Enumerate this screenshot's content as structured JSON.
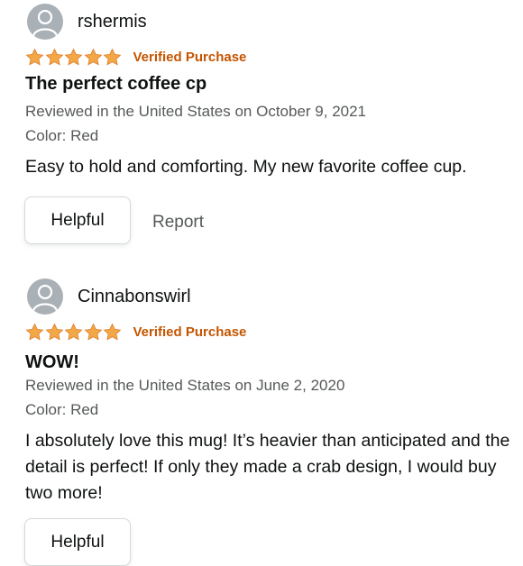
{
  "colors": {
    "star": "#f3a847",
    "verified": "#c45500",
    "secondary_text": "#565959"
  },
  "reviews": [
    {
      "reviewer": "rshermis",
      "rating": 5,
      "verified": "Verified Purchase",
      "title": "The perfect coffee cp",
      "date": "Reviewed in the United States on October 9, 2021",
      "variant": "Color: Red",
      "body": "Easy to hold and comforting. My new favorite coffee cup.",
      "helpful": "Helpful",
      "report": "Report"
    },
    {
      "reviewer": "Cinnabonswirl",
      "rating": 5,
      "verified": "Verified Purchase",
      "title": "WOW!",
      "date": "Reviewed in the United States on June 2, 2020",
      "variant": "Color: Red",
      "body": "I absolutely love this mug! It’s heavier than anticipated and the detail is perfect! If only they made a crab design, I would buy two more!",
      "helpful": "Helpful"
    }
  ]
}
